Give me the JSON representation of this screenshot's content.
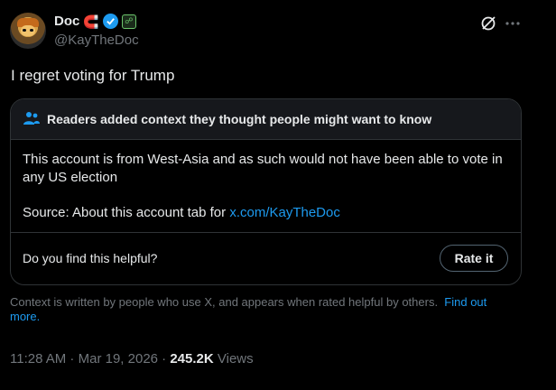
{
  "author": {
    "name": "Doc",
    "name_emoji": "🧲",
    "handle": "@KayTheDoc"
  },
  "tweet": {
    "text": "I regret voting for Trump"
  },
  "community_note": {
    "title": "Readers added context they thought people might want to know",
    "body": "This account is from West-Asia and as such would not have been able to vote in any US election",
    "source_prefix": "Source: About this account tab for ",
    "source_link": "x.com/KayTheDoc",
    "helpful_question": "Do you find this helpful?",
    "rate_button": "Rate it"
  },
  "context_disclaimer": {
    "text": "Context is written by people who use X, and appears when rated helpful by others.",
    "link": "Find out more."
  },
  "meta": {
    "time": "11:28 AM",
    "date": "Mar 19, 2026",
    "views_count": "245.2K",
    "views_label": "Views"
  },
  "colors": {
    "accent": "#1d9bf0",
    "muted": "#71767b",
    "border": "#2f3336"
  },
  "icons": [
    "verified-badge-icon",
    "affiliate-badge-icon",
    "grok-icon",
    "more-options-icon",
    "people-icon"
  ]
}
